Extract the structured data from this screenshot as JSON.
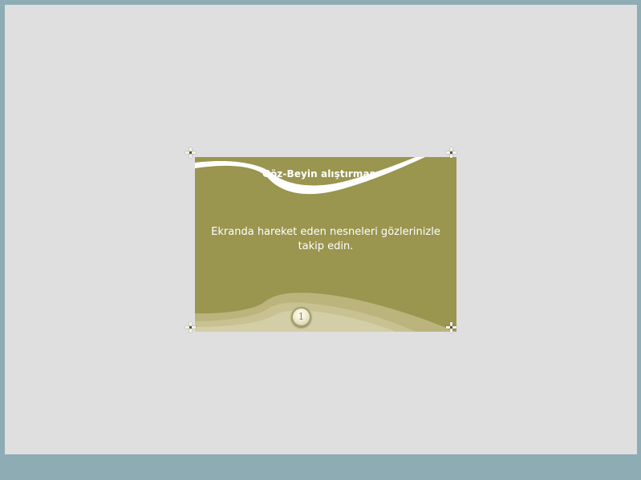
{
  "card": {
    "title": "Göz-Beyin alıştırması",
    "message": "Ekranda hareket eden nesneleri gözlerinizle takip edin.",
    "page_number": "1"
  },
  "colors": {
    "outer_frame": "#8eacb4",
    "stage_background": "#dfdfdf",
    "card_olive": "#9a954f",
    "wave_light": "#d3cea7",
    "text": "#ffffff"
  },
  "icons": {
    "corners": "corner-crosshair-icon",
    "badge": "page-number-badge"
  }
}
